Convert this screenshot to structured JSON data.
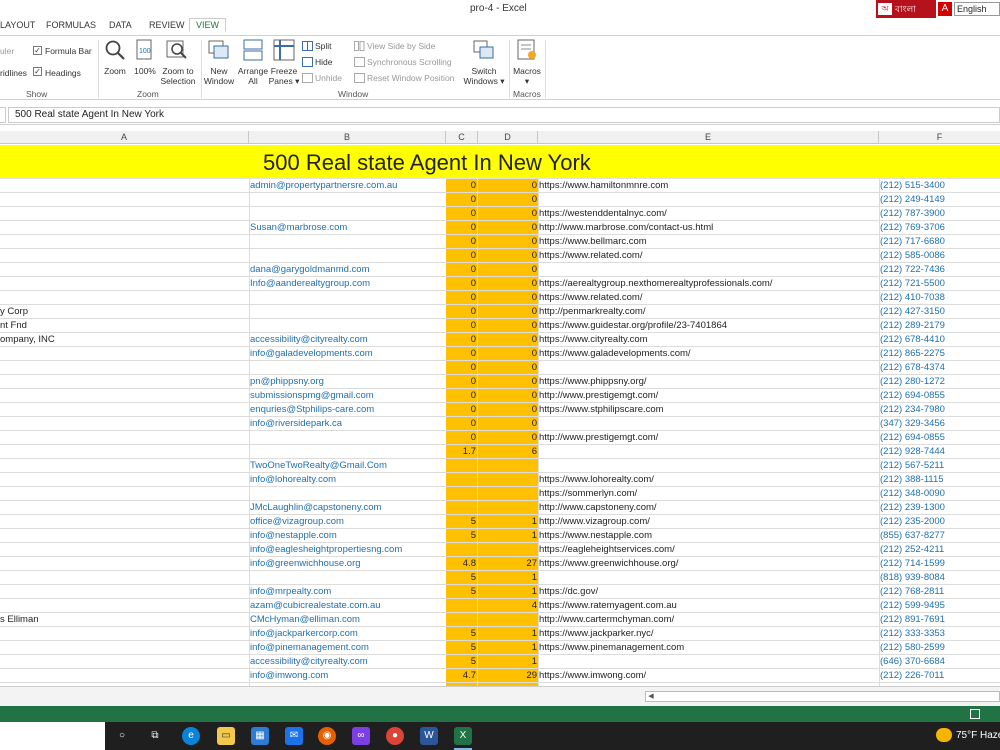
{
  "window": {
    "title": "pro-4 - Excel"
  },
  "language_bar": {
    "script_label": "বাংলা",
    "input_language": "English"
  },
  "ribbon_tabs": [
    "LAYOUT",
    "FORMULAS",
    "DATA",
    "REVIEW",
    "VIEW"
  ],
  "ribbon": {
    "show": {
      "ruler": "uler",
      "gridlines": "ridlines",
      "formula_bar": "Formula Bar",
      "headings": "Headings",
      "group": "Show"
    },
    "zoom": {
      "zoom": "Zoom",
      "hundred": "100%",
      "zoom_to_selection_1": "Zoom to",
      "zoom_to_selection_2": "Selection",
      "group": "Zoom"
    },
    "window": {
      "new_window_1": "New",
      "new_window_2": "Window",
      "arrange_all_1": "Arrange",
      "arrange_all_2": "All",
      "freeze_panes_1": "Freeze",
      "freeze_panes_2": "Panes ▾",
      "split": "Split",
      "hide": "Hide",
      "unhide": "Unhide",
      "view_side_by_side": "View Side by Side",
      "synchronous_scrolling": "Synchronous Scrolling",
      "reset_window_position": "Reset Window Position",
      "switch_windows_1": "Switch",
      "switch_windows_2": "Windows ▾",
      "group": "Window"
    },
    "macros": {
      "macros": "Macros",
      "macros_dd": "▾",
      "group": "Macros"
    }
  },
  "formula_bar": {
    "content": "500 Real state Agent In New York"
  },
  "columns": [
    "A",
    "B",
    "C",
    "D",
    "E",
    "F"
  ],
  "banner": "500 Real state Agent In New York",
  "rows": [
    {
      "a": "",
      "b": "admin@propertypartnersre.com.au",
      "c": "0",
      "d": "0",
      "e": "https://www.hamiltonmnre.com",
      "f": "(212) 515-3400"
    },
    {
      "a": "",
      "b": "",
      "c": "0",
      "d": "0",
      "e": "",
      "f": "(212) 249-4149"
    },
    {
      "a": "",
      "b": "",
      "c": "0",
      "d": "0",
      "e": "https://westenddentalnyc.com/",
      "f": "(212) 787-3900"
    },
    {
      "a": "",
      "b": "Susan@marbrose.com",
      "c": "0",
      "d": "0",
      "e": "http://www.marbrose.com/contact-us.html",
      "f": "(212) 769-3706"
    },
    {
      "a": "",
      "b": "",
      "c": "0",
      "d": "0",
      "e": "https://www.bellmarc.com",
      "f": "(212) 717-6680"
    },
    {
      "a": "",
      "b": "",
      "c": "0",
      "d": "0",
      "e": "https://www.related.com/",
      "f": "(212) 585-0086"
    },
    {
      "a": "",
      "b": "dana@garygoldmanmd.com",
      "c": "0",
      "d": "0",
      "e": "",
      "f": "(212) 722-7436"
    },
    {
      "a": "",
      "b": "Info@aanderealtygroup.com",
      "c": "0",
      "d": "0",
      "e": "https://aerealtygroup.nexthomerealtyprofessionals.com/",
      "f": "(212) 721-5500"
    },
    {
      "a": "",
      "b": "",
      "c": "0",
      "d": "0",
      "e": "https://www.related.com/",
      "f": "(212) 410-7038"
    },
    {
      "a": "y Corp",
      "b": "",
      "c": "0",
      "d": "0",
      "e": "http://penmarkrealty.com/",
      "f": "(212) 427-3150"
    },
    {
      "a": "nt Fnd",
      "b": "",
      "c": "0",
      "d": "0",
      "e": "https://www.guidestar.org/profile/23-7401864",
      "f": "(212) 289-2179"
    },
    {
      "a": "ompany, INC",
      "b": "accessibility@cityrealty.com",
      "c": "0",
      "d": "0",
      "e": "https://www.cityrealty.com",
      "f": "(212) 678-4410"
    },
    {
      "a": "",
      "b": "info@galadevelopments.com",
      "c": "0",
      "d": "0",
      "e": "https://www.galadevelopments.com/",
      "f": "(212) 865-2275"
    },
    {
      "a": "",
      "b": "",
      "c": "0",
      "d": "0",
      "e": "",
      "f": "(212) 678-4374"
    },
    {
      "a": "",
      "b": "pn@phippsny.org",
      "c": "0",
      "d": "0",
      "e": "https://www.phippsny.org/",
      "f": "(212) 280-1272"
    },
    {
      "a": "",
      "b": "submissionspmg@gmail.com",
      "c": "0",
      "d": "0",
      "e": "http://www.prestigemgt.com/",
      "f": "(212) 694-0855"
    },
    {
      "a": "",
      "b": "enquries@Stphilips-care.com",
      "c": "0",
      "d": "0",
      "e": "https://www.stphilipscare.com",
      "f": "(212) 234-7980"
    },
    {
      "a": "",
      "b": "info@riversidepark.ca",
      "c": "0",
      "d": "0",
      "e": "",
      "f": "(347) 329-3456"
    },
    {
      "a": "",
      "b": "",
      "c": "0",
      "d": "0",
      "e": "http://www.prestigemgt.com/",
      "f": "(212) 694-0855"
    },
    {
      "a": "",
      "b": "",
      "c": "1.7",
      "d": "6",
      "e": "",
      "f": "(212) 928-7444"
    },
    {
      "a": "",
      "b": "TwoOneTwoRealty@Gmail.Com",
      "c": "",
      "d": "",
      "e": "",
      "f": "(212) 567-5211"
    },
    {
      "a": "",
      "b": "info@lohorealty.com",
      "c": "",
      "d": "",
      "e": "https://www.lohorealty.com/",
      "f": "(212) 388-1115"
    },
    {
      "a": "",
      "b": "",
      "c": "",
      "d": "",
      "e": "https://sommerlyn.com/",
      "f": "(212) 348-0090"
    },
    {
      "a": "",
      "b": "JMcLaughlin@capstoneny.com",
      "c": "",
      "d": "",
      "e": "http://www.capstoneny.com/",
      "f": "(212) 239-1300"
    },
    {
      "a": "",
      "b": "office@vizagroup.com",
      "c": "5",
      "d": "1",
      "e": "http://www.vizagroup.com/",
      "f": "(212) 235-2000"
    },
    {
      "a": "",
      "b": "info@nestapple.com",
      "c": "5",
      "d": "1",
      "e": "https://www.nestapple.com",
      "f": "(855) 637-8277"
    },
    {
      "a": "",
      "b": "info@eaglesheightpropertiesng.com",
      "c": "",
      "d": "",
      "e": "https://eagleheightservices.com/",
      "f": "(212) 252-4211"
    },
    {
      "a": "",
      "b": "info@greenwichhouse.org",
      "c": "4.8",
      "d": "27",
      "e": "https://www.greenwichhouse.org/",
      "f": "(212) 714-1599"
    },
    {
      "a": "",
      "b": "",
      "c": "5",
      "d": "1",
      "e": "",
      "f": "(818) 939-8084"
    },
    {
      "a": "",
      "b": "info@mrpealty.com",
      "c": "5",
      "d": "1",
      "e": "https://dc.gov/",
      "f": "(212) 768-2811"
    },
    {
      "a": "",
      "b": "azam@cubicrealestate.com.au",
      "c": "",
      "d": "4",
      "e": "https://www.ratemyagent.com.au",
      "f": "(212) 599-9495"
    },
    {
      "a": "s Elliman",
      "b": "CMcHyman@elliman.com",
      "c": "",
      "d": "",
      "e": "http://www.cartermchyman.com/",
      "f": "(212) 891-7691"
    },
    {
      "a": "",
      "b": "info@jackparkercorp.com",
      "c": "5",
      "d": "1",
      "e": "https://www.jackparker.nyc/",
      "f": "(212) 333-3353"
    },
    {
      "a": "",
      "b": "info@pinemanagement.com",
      "c": "5",
      "d": "1",
      "e": "https://www.pinemanagement.com",
      "f": "(212) 580-2599"
    },
    {
      "a": "",
      "b": "accessibility@cityrealty.com",
      "c": "5",
      "d": "1",
      "e": "",
      "f": "(646) 370-6684"
    },
    {
      "a": "",
      "b": "info@imwong.com",
      "c": "4.7",
      "d": "29",
      "e": "https://www.imwong.com/",
      "f": "(212) 226-7011"
    }
  ],
  "taskbar": {
    "temperature": "75°F Haze"
  },
  "colors": {
    "banner": "#ffff00",
    "highlight_columns": "#ffc000",
    "excel_green": "#217346",
    "link_blue": "#1f6fb0"
  }
}
